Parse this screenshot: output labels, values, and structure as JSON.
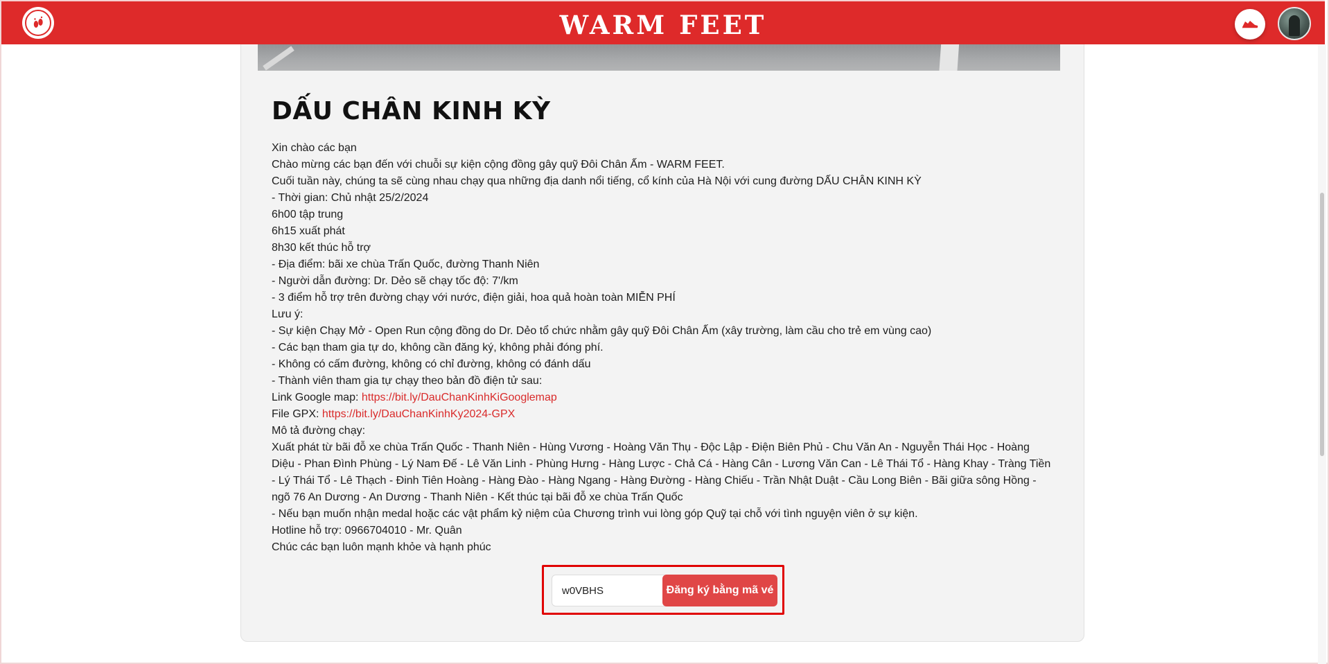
{
  "header": {
    "title": "WARM FEET",
    "logo_icon": "warm-feet-logo-icon",
    "shoe_icon": "running-shoe-icon",
    "brand_color": "#de2a2a"
  },
  "event": {
    "title": "DẤU CHÂN KINH KỲ",
    "lines": [
      "Xin chào các bạn",
      "Chào mừng các bạn đến với chuỗi sự kiện cộng đồng gây quỹ Đôi Chân Ấm - WARM FEET.",
      "Cuối tuần này, chúng ta sẽ cùng nhau chạy qua những địa danh nổi tiếng, cổ kính của Hà Nội với cung đường DẤU CHÂN KINH KỲ",
      "- Thời gian: Chủ nhật 25/2/2024",
      "6h00 tập trung",
      "6h15 xuất phát",
      "8h30 kết thúc hỗ trợ",
      "- Địa điểm: bãi xe chùa Trấn Quốc, đường Thanh Niên",
      "- Người dẫn đường: Dr. Dẻo sẽ chạy tốc độ: 7'/km",
      "- 3 điểm hỗ trợ trên đường chạy với nước, điện giải, hoa quả hoàn toàn MIỄN PHÍ",
      "Lưu ý:",
      "- Sự kiện Chạy Mở - Open Run cộng đồng do Dr. Dẻo tổ chức nhằm gây quỹ Đôi Chân Ấm (xây trường, làm cầu cho trẻ em vùng cao)",
      "- Các bạn tham gia tự do, không cần đăng ký, không phải đóng phí.",
      "- Không có cấm đường, không có chỉ đường, không có đánh dấu",
      "- Thành viên tham gia tự chạy theo bản đồ điện tử sau:"
    ],
    "google_map_label": "Link Google map: ",
    "google_map_link": "https://bit.ly/DauChanKinhKiGooglemap",
    "gpx_label": "File GPX: ",
    "gpx_link": "https://bit.ly/DauChanKinhKy2024-GPX",
    "route_heading": "Mô tả đường chạy:",
    "route_description": "Xuất phát từ bãi đỗ xe chùa Trấn Quốc - Thanh Niên - Hùng Vương - Hoàng Văn Thụ - Độc Lập - Điện Biên Phủ - Chu Văn An - Nguyễn Thái Học - Hoàng Diệu - Phan Đình Phùng - Lý Nam Đế - Lê Văn Linh - Phùng Hưng - Hàng Lược - Chả Cá - Hàng Cân - Lương Văn Can - Lê Thái Tổ - Hàng Khay - Tràng Tiền - Lý Thái Tổ - Lê Thạch - Đinh Tiên Hoàng - Hàng Đào - Hàng Ngang - Hàng Đường - Hàng Chiếu - Trần Nhật Duật - Cầu Long Biên - Bãi giữa sông Hồng - ngõ 76 An Dương - An Dương - Thanh Niên - Kết thúc tại bãi đỗ xe chùa Trấn Quốc",
    "closing_lines": [
      "- Nếu bạn muốn nhận medal hoặc các vật phẩm kỷ niệm của Chương trình vui lòng góp Quỹ tại chỗ với tình nguyện viên ở sự kiện.",
      "Hotline hỗ trợ: 0966704010 - Mr. Quân",
      "Chúc các bạn luôn mạnh khỏe và hạnh phúc"
    ]
  },
  "register": {
    "code_value": "w0VBHS",
    "button_label": "Đăng ký bằng mã vé",
    "highlight_color": "#e00000",
    "button_color": "#e04646"
  }
}
